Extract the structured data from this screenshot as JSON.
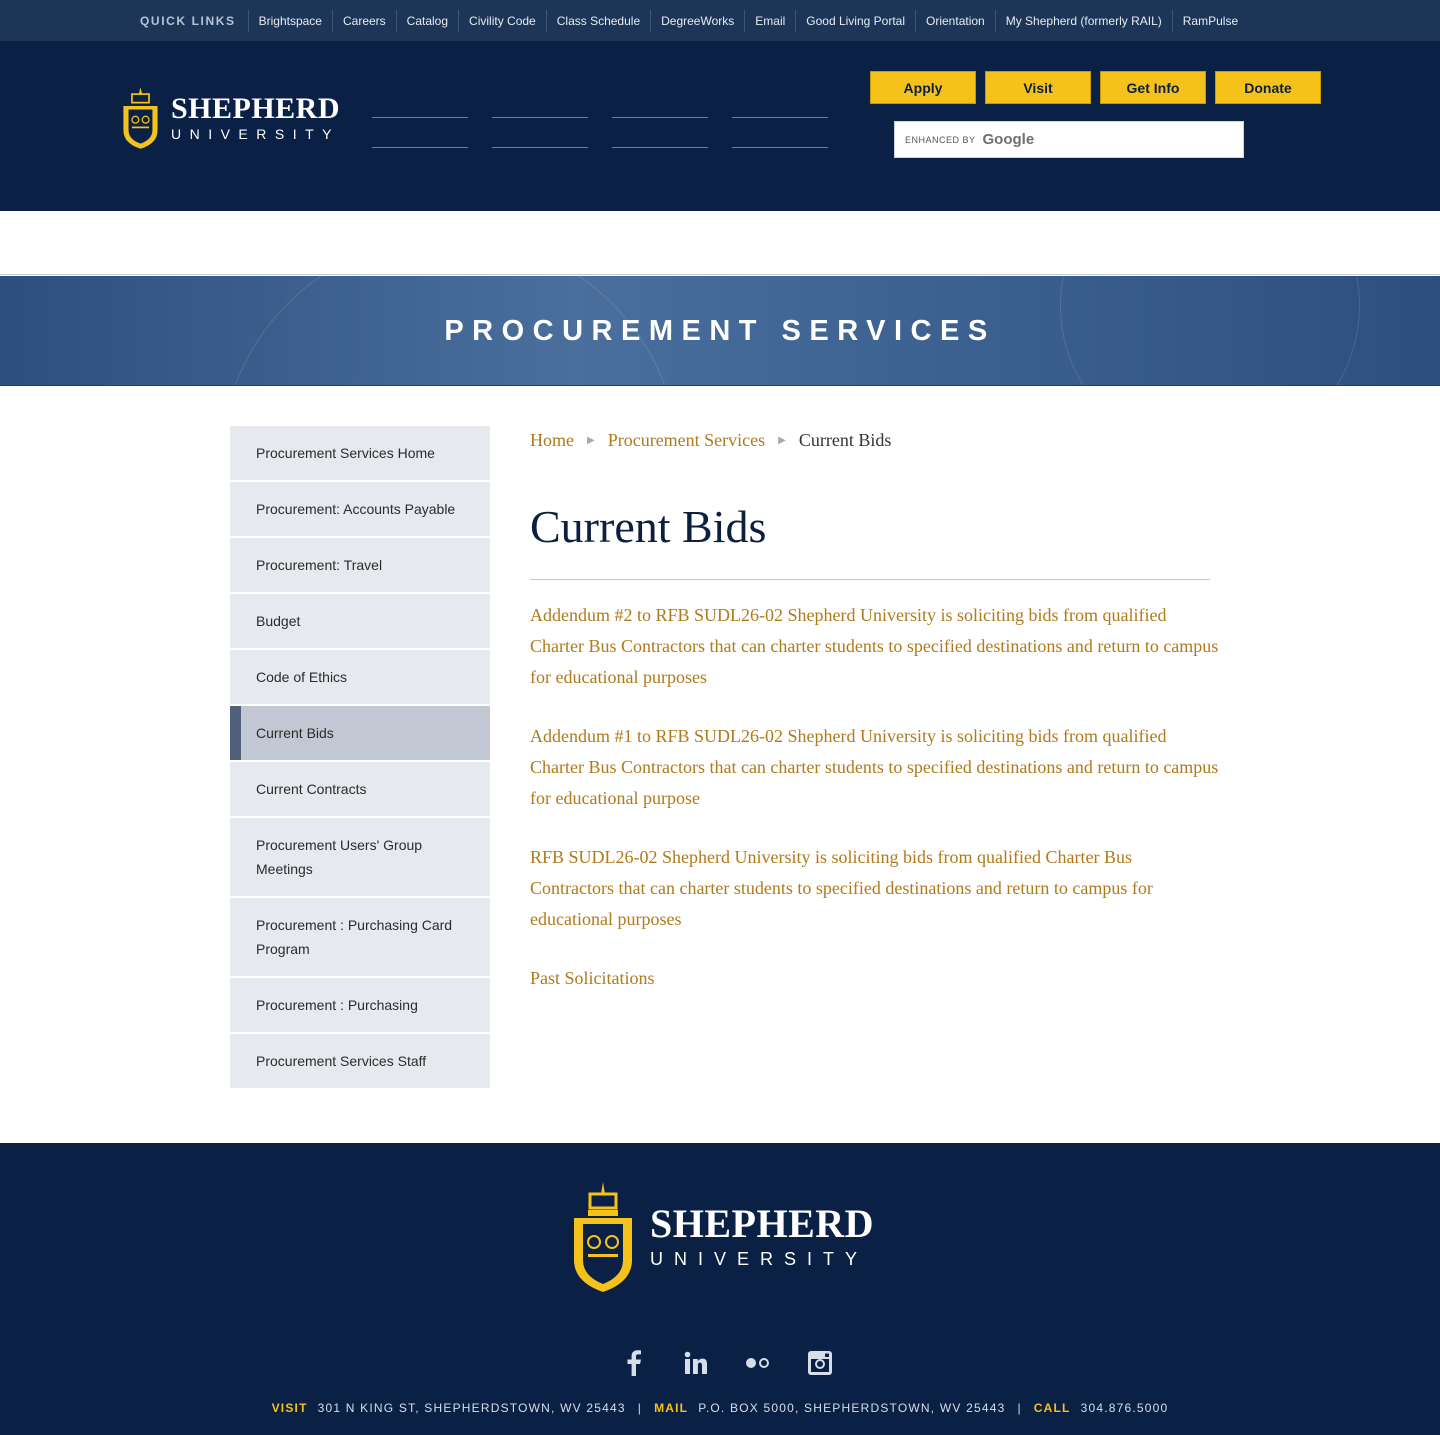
{
  "quick_links": {
    "title": "QUICK LINKS",
    "items": [
      "Brightspace",
      "Careers",
      "Catalog",
      "Civility Code",
      "Class Schedule",
      "DegreeWorks",
      "Email",
      "Good Living Portal",
      "Orientation",
      "My Shepherd (formerly RAIL)",
      "RamPulse"
    ]
  },
  "brand": {
    "name": "SHEPHERD",
    "sub": "UNIVERSITY",
    "primary_color": "#0b2045",
    "accent_color": "#f4c21a"
  },
  "cta": {
    "apply": "Apply",
    "visit": "Visit",
    "get_info": "Get Info",
    "donate": "Donate"
  },
  "search": {
    "enhanced_by": "ENHANCED BY",
    "provider": "Google"
  },
  "hero": {
    "title": "PROCUREMENT SERVICES"
  },
  "sidebar": {
    "items": [
      "Procurement Services Home",
      "Procurement: Accounts Payable",
      "Procurement: Travel",
      "Budget",
      "Code of Ethics",
      "Current Bids",
      "Current Contracts",
      "Procurement Users' Group Meetings",
      "Procurement : Purchasing Card Program",
      "Procurement : Purchasing",
      "Procurement Services Staff"
    ],
    "active": "Current Bids"
  },
  "breadcrumb": {
    "home": "Home",
    "section": "Procurement Services",
    "current": "Current Bids"
  },
  "page": {
    "title": "Current Bids",
    "links": [
      "Addendum #2 to RFB SUDL26-02 Shepherd University is soliciting bids from qualified Charter Bus Contractors that can charter students to specified destinations and return to campus for educational purposes",
      "Addendum #1 to RFB SUDL26-02 Shepherd University is soliciting bids from qualified Charter Bus Contractors that can charter students to specified destinations and return to campus for educational purpose",
      "RFB SUDL26-02 Shepherd University is soliciting bids from qualified Charter Bus Contractors that can charter students to specified destinations and return to campus for educational purposes",
      "Past Solicitations"
    ]
  },
  "footer": {
    "visit_label": "VISIT",
    "visit_value": "301 N KING ST, SHEPHERDSTOWN, WV 25443",
    "mail_label": "MAIL",
    "mail_value": "P.O. BOX 5000, SHEPHERDSTOWN, WV 25443",
    "call_label": "CALL",
    "call_value": "304.876.5000",
    "socials": [
      "facebook-icon",
      "linkedin-icon",
      "flickr-icon",
      "instagram-icon"
    ]
  }
}
